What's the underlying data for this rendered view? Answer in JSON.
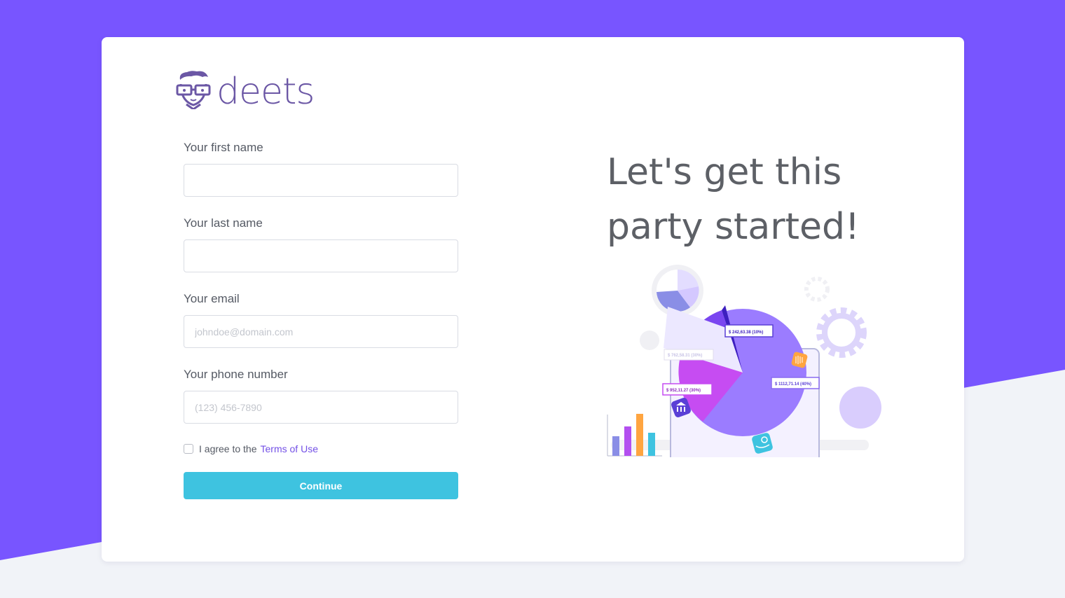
{
  "brand": {
    "name": "deets",
    "color": "#6b57a5"
  },
  "colors": {
    "accent": "#7855ff",
    "button": "#3ec3e0",
    "link": "#7350e6"
  },
  "form": {
    "first_name": {
      "label": "Your first name",
      "value": "",
      "placeholder": ""
    },
    "last_name": {
      "label": "Your last name",
      "value": "",
      "placeholder": ""
    },
    "email": {
      "label": "Your email",
      "value": "",
      "placeholder": "johndoe@domain.com"
    },
    "phone": {
      "label": "Your phone number",
      "value": "",
      "placeholder": "(123) 456-7890"
    },
    "agree": {
      "checked": false,
      "prefix": "I agree to the",
      "link_text": "Terms of Use"
    },
    "continue_label": "Continue"
  },
  "hero": {
    "headline": "Let's get this party started!"
  },
  "illustration": {
    "labels": [
      "$ 242,63.38 (10%)",
      "$ 762,58.31 (30%)",
      "$ 952,11.27 (30%)",
      "$ 1112,71.14 (40%)"
    ],
    "icons": [
      "face-logo-icon",
      "bank-icon",
      "hand-coin-icon",
      "barcode-icon",
      "gear-icon"
    ]
  }
}
